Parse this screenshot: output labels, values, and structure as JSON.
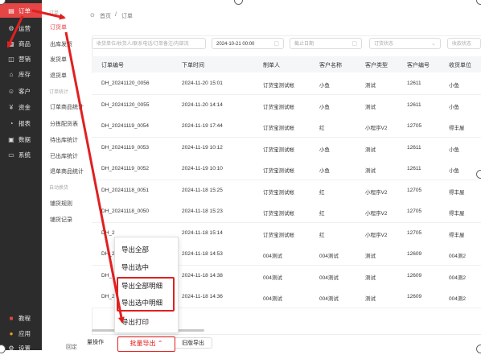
{
  "sidebar": {
    "items": [
      {
        "label": "订单",
        "icon": "order-icon"
      },
      {
        "label": "运营",
        "icon": "operation-icon"
      },
      {
        "label": "商品",
        "icon": "goods-icon"
      },
      {
        "label": "营销",
        "icon": "marketing-icon"
      },
      {
        "label": "库存",
        "icon": "warehouse-icon"
      },
      {
        "label": "客户",
        "icon": "customer-icon"
      },
      {
        "label": "资金",
        "icon": "money-icon"
      },
      {
        "label": "报表",
        "icon": "report-icon"
      },
      {
        "label": "数据",
        "icon": "data-icon"
      },
      {
        "label": "系统",
        "icon": "system-icon"
      }
    ],
    "bottom_items": [
      {
        "label": "教程",
        "icon": "tutorial-icon"
      },
      {
        "label": "应用",
        "icon": "app-icon"
      },
      {
        "label": "设置",
        "icon": "settings-icon"
      }
    ],
    "accent": "#e64545"
  },
  "submenu": {
    "group1_title": "订单",
    "items1": [
      "订货单",
      "出库发货",
      "发货单",
      "退货单"
    ],
    "group2_title": "订单统计",
    "items2": [
      "订单商品统计",
      "分拣配货表",
      "待出库统计",
      "已出库统计",
      "退单商品统计"
    ],
    "group3_title": "自动换货",
    "items3": [
      "铺货规则",
      "铺货记录"
    ],
    "collapse_label": "回定"
  },
  "header": {
    "breadcrumb_home": "首页",
    "breadcrumb_sep": "/",
    "breadcrumb_current": "订单"
  },
  "filters": {
    "keyword_placeholder": "收货单位/收货人/联系电话/订单备注/内部流",
    "start_date": "2024-10-21 00:00",
    "end_date_placeholder": "截止日期",
    "order_status_placeholder": "订货状态",
    "receive_status_placeholder": "收款状态"
  },
  "table": {
    "columns": [
      "订单编号",
      "下单时间",
      "制单人",
      "客户名称",
      "客户类型",
      "客户编号",
      "收货单位"
    ],
    "rows": [
      {
        "id": "DH_20241120_0056",
        "time": "2024-11-20 15:01",
        "maker": "订货宝测试帐",
        "customer": "小鱼",
        "type": "测试",
        "code": "12611",
        "unit": "小鱼"
      },
      {
        "id": "DH_20241120_0055",
        "time": "2024-11-20 14:14",
        "maker": "订货宝测试帐",
        "customer": "小鱼",
        "type": "测试",
        "code": "12611",
        "unit": "小鱼"
      },
      {
        "id": "DH_20241119_0054",
        "time": "2024-11-19 17:44",
        "maker": "订货宝测试帐",
        "customer": "红",
        "type": "小程序V2",
        "code": "12705",
        "unit": "得丰屋"
      },
      {
        "id": "DH_20241119_0053",
        "time": "2024-11-19 10:12",
        "maker": "订货宝测试帐",
        "customer": "小鱼",
        "type": "测试",
        "code": "12611",
        "unit": "小鱼"
      },
      {
        "id": "DH_20241119_0052",
        "time": "2024-11-19 10:10",
        "maker": "订货宝测试帐",
        "customer": "小鱼",
        "type": "测试",
        "code": "12611",
        "unit": "小鱼"
      },
      {
        "id": "DH_20241118_0051",
        "time": "2024-11-18 15:25",
        "maker": "订货宝测试帐",
        "customer": "红",
        "type": "小程序V2",
        "code": "12705",
        "unit": "得丰屋"
      },
      {
        "id": "DH_20241118_0050",
        "time": "2024-11-18 15:23",
        "maker": "订货宝测试帐",
        "customer": "红",
        "type": "小程序V2",
        "code": "12705",
        "unit": "得丰屋"
      },
      {
        "id": "DH_2",
        "time": "2024-11-18 15:14",
        "maker": "订货宝测试帐",
        "customer": "红",
        "type": "小程序V2",
        "code": "12705",
        "unit": "得丰屋"
      },
      {
        "id": "DH_2",
        "time": "2024-11-18 14:53",
        "maker": "004测试",
        "customer": "004测试",
        "type": "测试",
        "code": "12609",
        "unit": "004测2"
      },
      {
        "id": "DH_2",
        "time": "2024-11-18 14:38",
        "maker": "004测试",
        "customer": "004测试",
        "type": "测试",
        "code": "12609",
        "unit": "004测2"
      },
      {
        "id": "DH_2",
        "time": "2024-11-18 14:36",
        "maker": "004测试",
        "customer": "004测试",
        "type": "测试",
        "code": "12609",
        "unit": "004测2"
      }
    ]
  },
  "export_menu": {
    "items": [
      "导出全部",
      "导出选中",
      "导出全部明细",
      "导出选中明细",
      "导出打印"
    ],
    "highlight_color": "#e02020"
  },
  "bottom_bar": {
    "batch_ops_label": "量操作",
    "batch_export_label": "批量导出",
    "print_label": "旧版导出"
  }
}
